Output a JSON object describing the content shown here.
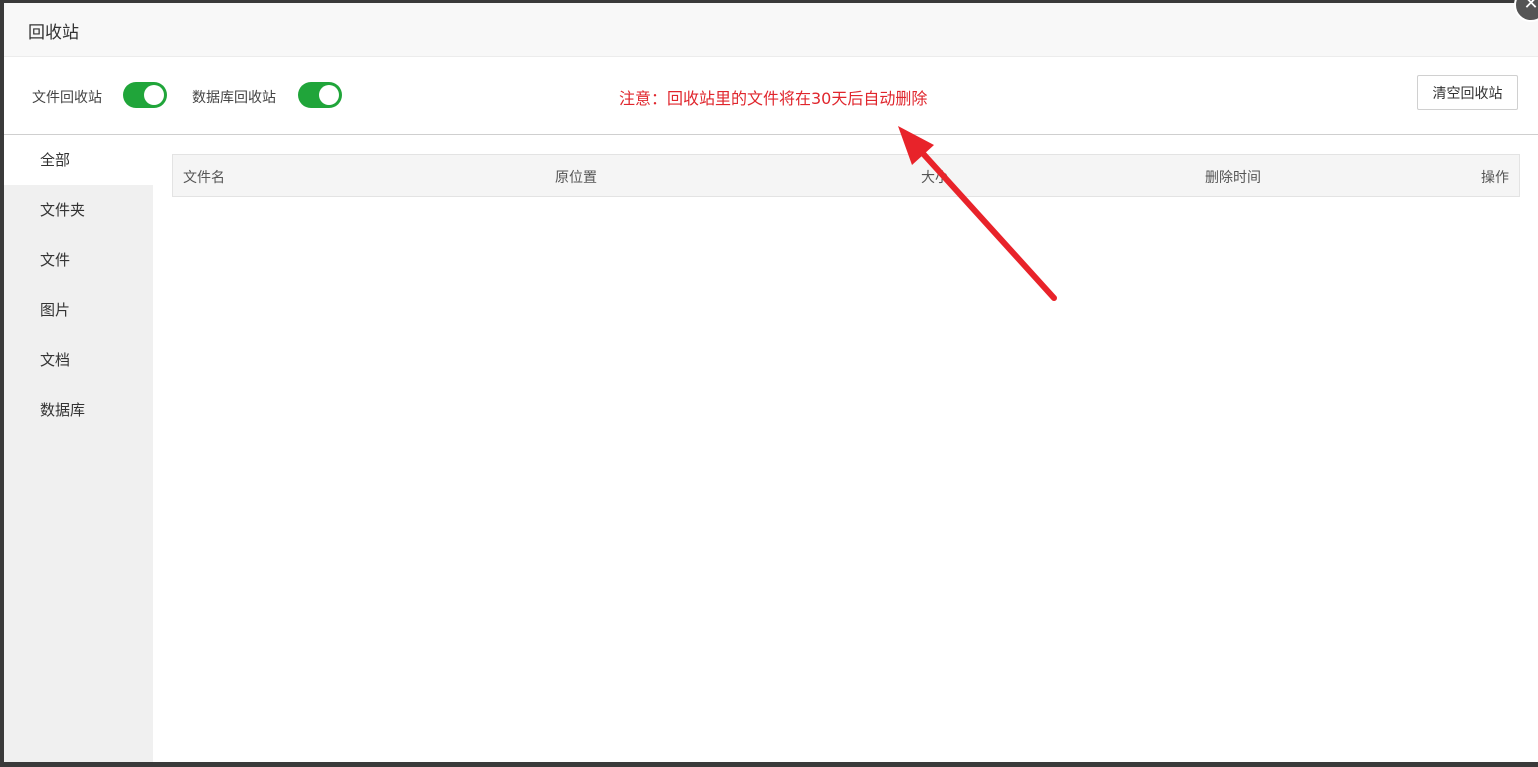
{
  "dialog": {
    "title": "回收站",
    "close_icon": "close-icon"
  },
  "toolbar": {
    "file_recycle_label": "文件回收站",
    "file_recycle_enabled": true,
    "db_recycle_label": "数据库回收站",
    "db_recycle_enabled": true,
    "notice": "注意：回收站里的文件将在30天后自动删除",
    "clear_button": "清空回收站"
  },
  "sidebar": {
    "items": [
      {
        "label": "全部",
        "active": true
      },
      {
        "label": "文件夹"
      },
      {
        "label": "文件"
      },
      {
        "label": "图片"
      },
      {
        "label": "文档"
      },
      {
        "label": "数据库"
      }
    ]
  },
  "table": {
    "columns": [
      "文件名",
      "原位置",
      "大小",
      "删除时间",
      "操作"
    ],
    "rows": []
  },
  "colors": {
    "toggle_on": "#20a53a",
    "notice": "#e0262d",
    "annotation_arrow": "#e8232a"
  }
}
